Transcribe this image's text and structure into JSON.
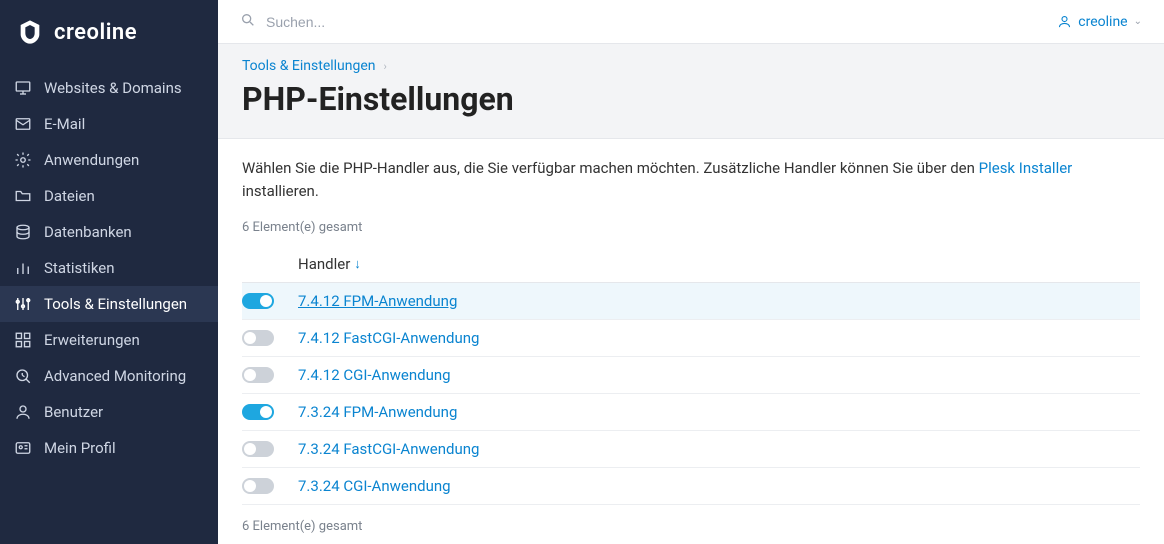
{
  "brand": {
    "name": "creoline"
  },
  "topbar": {
    "search_placeholder": "Suchen...",
    "user": "creoline"
  },
  "sidebar": {
    "items": [
      {
        "icon": "monitor",
        "label": "Websites & Domains",
        "active": false
      },
      {
        "icon": "mail",
        "label": "E-Mail",
        "active": false
      },
      {
        "icon": "gear",
        "label": "Anwendungen",
        "active": false
      },
      {
        "icon": "folder",
        "label": "Dateien",
        "active": false
      },
      {
        "icon": "database",
        "label": "Datenbanken",
        "active": false
      },
      {
        "icon": "stats",
        "label": "Statistiken",
        "active": false
      },
      {
        "icon": "sliders",
        "label": "Tools & Einstellungen",
        "active": true
      },
      {
        "icon": "grid",
        "label": "Erweiterungen",
        "active": false
      },
      {
        "icon": "monitor2",
        "label": "Advanced Monitoring",
        "active": false
      },
      {
        "icon": "user",
        "label": "Benutzer",
        "active": false
      },
      {
        "icon": "idcard",
        "label": "Mein Profil",
        "active": false
      }
    ]
  },
  "header": {
    "breadcrumb": "Tools & Einstellungen",
    "title": "PHP-Einstellungen"
  },
  "content": {
    "intro_prefix": "Wählen Sie die PHP-Handler aus, die Sie verfügbar machen möchten. Zusätzliche Handler können Sie über den ",
    "intro_link": "Plesk Installer",
    "intro_suffix": " installieren.",
    "count_label": "6 Element(e) gesamt",
    "column_header": "Handler",
    "rows": [
      {
        "enabled": true,
        "label": "7.4.12 FPM-Anwendung",
        "hover": true
      },
      {
        "enabled": false,
        "label": "7.4.12 FastCGI-Anwendung",
        "hover": false
      },
      {
        "enabled": false,
        "label": "7.4.12 CGI-Anwendung",
        "hover": false
      },
      {
        "enabled": true,
        "label": "7.3.24 FPM-Anwendung",
        "hover": false
      },
      {
        "enabled": false,
        "label": "7.3.24 FastCGI-Anwendung",
        "hover": false
      },
      {
        "enabled": false,
        "label": "7.3.24 CGI-Anwendung",
        "hover": false
      }
    ]
  }
}
